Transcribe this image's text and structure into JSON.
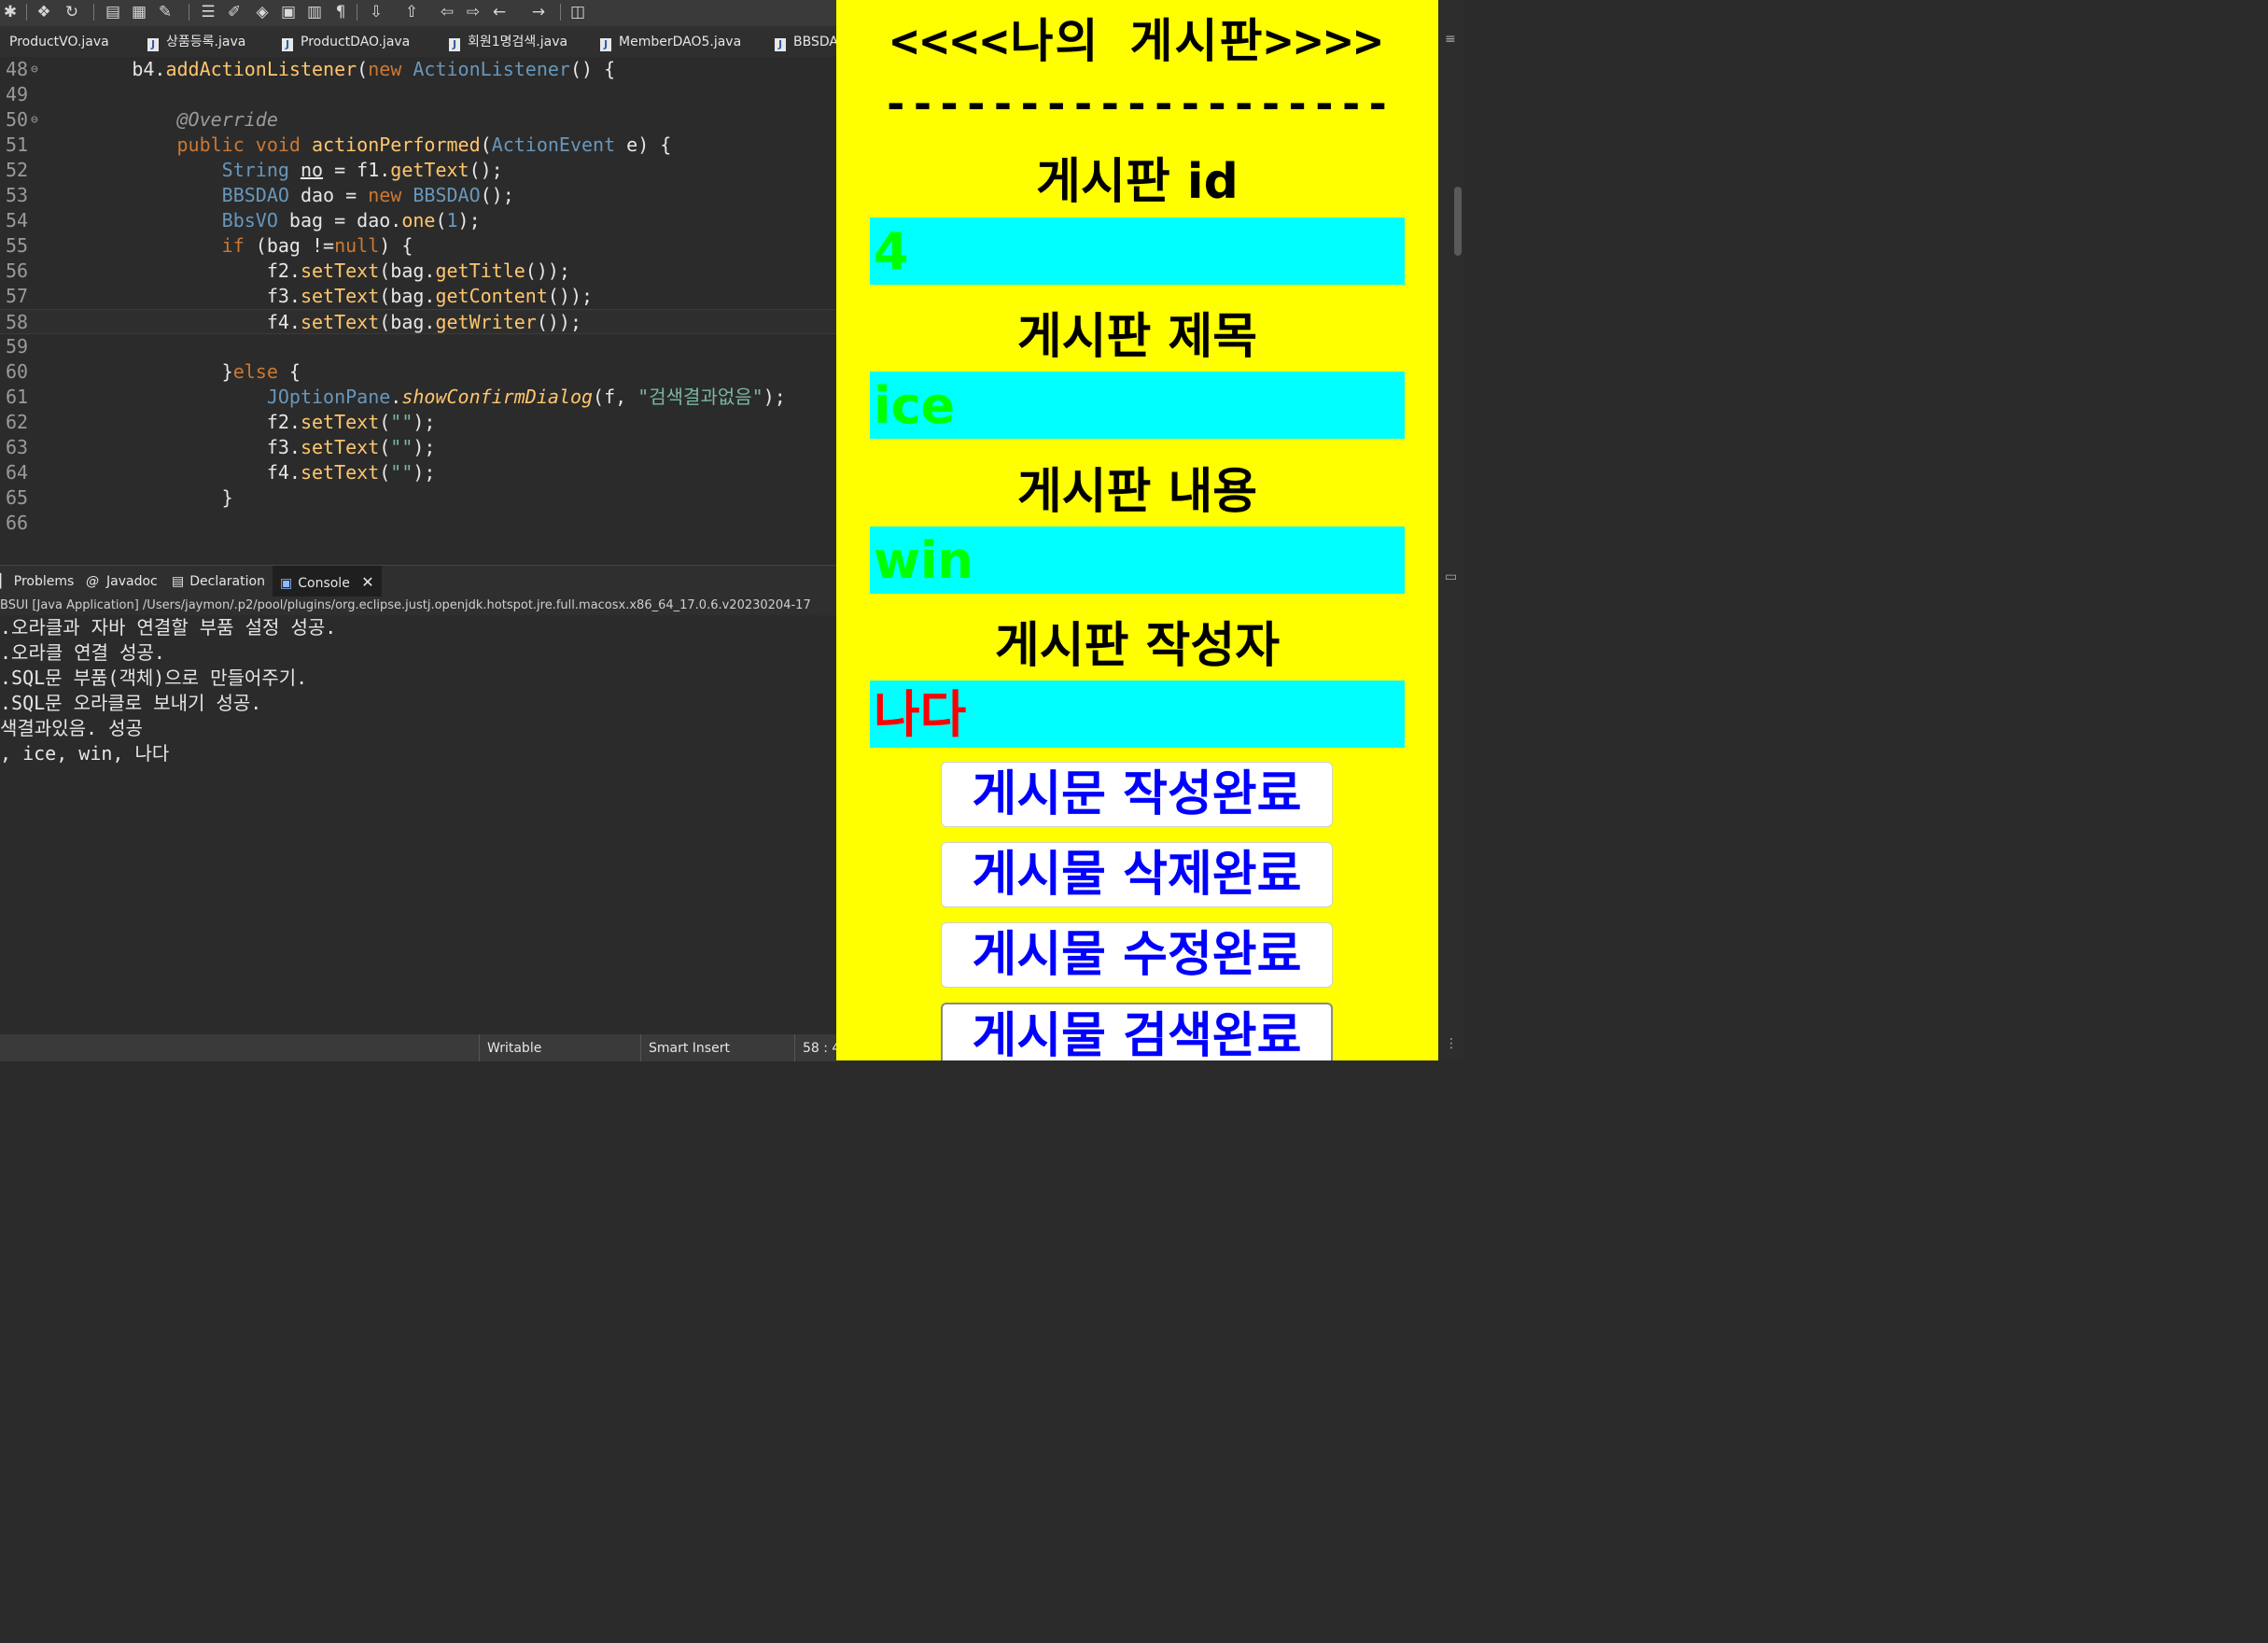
{
  "toolbar": {
    "icons": [
      "debug-icon",
      "new-java-project-icon",
      "run-icon",
      "open-type-icon",
      "open-folder-icon",
      "annotation-icon",
      "task-icon",
      "edit-icon",
      "step-icon",
      "paste-icon",
      "layout-icon",
      "paragraph-icon",
      "next-annotation-icon",
      "prev-annotation-icon",
      "back-icon",
      "forward-icon",
      "left-icon",
      "right-icon",
      "new-window-icon"
    ]
  },
  "editor_tabs": [
    {
      "label": "ProductVO.java"
    },
    {
      "label": "상품등록.java"
    },
    {
      "label": "ProductDAO.java"
    },
    {
      "label": "회원1명검색.java"
    },
    {
      "label": "MemberDAO5.java"
    },
    {
      "label": "BBSDA"
    }
  ],
  "code_lines": [
    {
      "no": "48",
      "fold": "⊖",
      "html": "        b4.addActionListener(new ActionListener() {"
    },
    {
      "no": "49",
      "fold": "",
      "html": ""
    },
    {
      "no": "50",
      "fold": "⊖",
      "html": "            @Override"
    },
    {
      "no": "51",
      "fold": "",
      "html": "            public void actionPerformed(ActionEvent e) {"
    },
    {
      "no": "52",
      "fold": "",
      "html": "                String no = f1.getText();"
    },
    {
      "no": "53",
      "fold": "",
      "html": "                BBSDAO dao = new BBSDAO();"
    },
    {
      "no": "54",
      "fold": "",
      "html": "                BbsVO bag = dao.one(1);"
    },
    {
      "no": "55",
      "fold": "",
      "html": "                if (bag !=null) {"
    },
    {
      "no": "56",
      "fold": "",
      "html": "                    f2.setText(bag.getTitle());"
    },
    {
      "no": "57",
      "fold": "",
      "html": "                    f3.setText(bag.getContent());"
    },
    {
      "no": "58",
      "fold": "",
      "html": "                    f4.setText(bag.getWriter());"
    },
    {
      "no": "59",
      "fold": "",
      "html": ""
    },
    {
      "no": "60",
      "fold": "",
      "html": "                }else {"
    },
    {
      "no": "61",
      "fold": "",
      "html": "                    JOptionPane.showConfirmDialog(f, \"검색결과없음\");"
    },
    {
      "no": "62",
      "fold": "",
      "html": "                    f2.setText(\"\");"
    },
    {
      "no": "63",
      "fold": "",
      "html": "                    f3.setText(\"\");"
    },
    {
      "no": "64",
      "fold": "",
      "html": "                    f4.setText(\"\");"
    },
    {
      "no": "65",
      "fold": "",
      "html": "                }"
    },
    {
      "no": "66",
      "fold": "",
      "html": ""
    }
  ],
  "console_tabs": [
    {
      "label": "Problems"
    },
    {
      "label": "Javadoc"
    },
    {
      "label": "Declaration"
    },
    {
      "label": "Console"
    }
  ],
  "console_path": "BSUI [Java Application] /Users/jaymon/.p2/pool/plugins/org.eclipse.justj.openjdk.hotspot.jre.full.macosx.x86_64_17.0.6.v20230204-17",
  "console_lines": [
    ".오라클과 자바 연결할 부품 설정 성공.",
    ".오라클 연결 성공.",
    ".SQL문 부품(객체)으로 만들어주기.",
    ".SQL문 오라클로 보내기 성공.",
    "색결과있음. 성공",
    ", ice, win, 나다"
  ],
  "status": {
    "writable": "Writable",
    "insert_mode": "Smart Insert",
    "position": "58 : 4"
  },
  "board": {
    "title": "<<<<나의 게시판>>>>",
    "divider": "-------------------",
    "labels": {
      "id": "게시판 id",
      "title": "게시판 제목",
      "content": "게시판 내용",
      "writer": "게시판 작성자"
    },
    "fields": {
      "id": "4",
      "title": "ice",
      "content": "win",
      "writer": "나다"
    },
    "buttons": {
      "create": "게시문 작성완료",
      "delete": "게시물 삭제완료",
      "update": "게시물 수정완료",
      "search": "게시물 검색완료"
    },
    "colors": {
      "background": "#ffff00",
      "field_bg": "#00ffff",
      "id_text": "#00ff00",
      "title_text": "#00ff00",
      "content_text": "#00ff00",
      "writer_text": "#ff0000",
      "button_text": "#0000ff"
    }
  }
}
